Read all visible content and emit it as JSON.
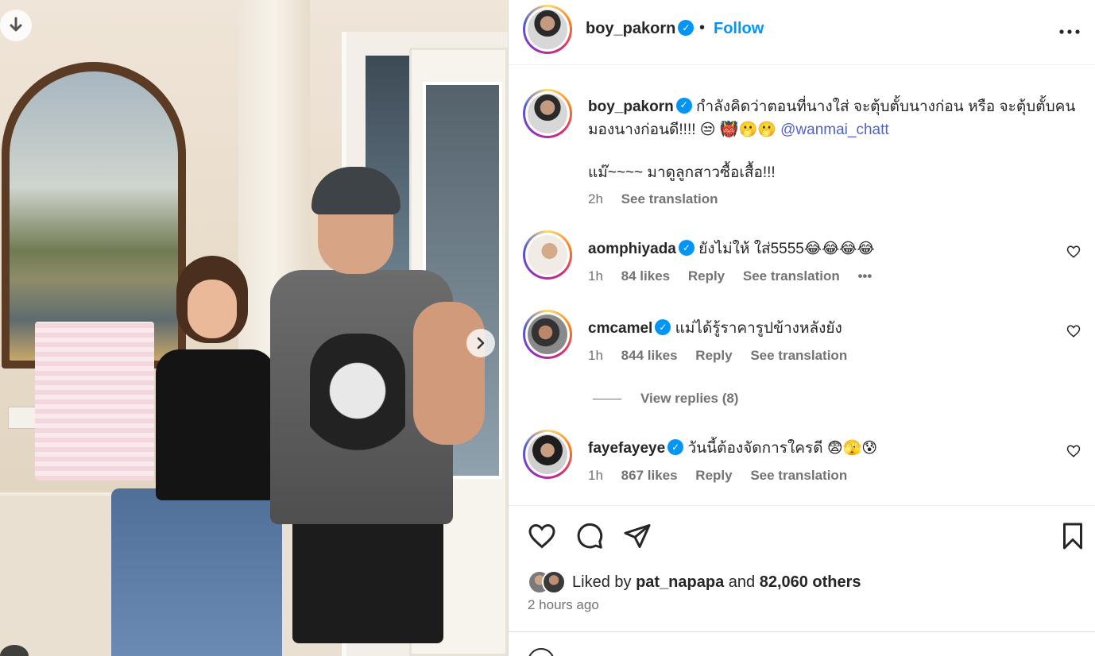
{
  "post": {
    "username": "boy_pakorn",
    "follow_label": "Follow",
    "dot": "•",
    "more_label": "···"
  },
  "caption": {
    "username": "boy_pakorn",
    "text_1": "กำลังคิดว่าตอนที่นางใส่ จะตุ้บตั้บนางก่อน หรือ จะตุ้บตั้บคนมองนางก่อนดี!!!! 😒 👹🫢🫢 ",
    "mention": "@wanmai_chatt",
    "text_2": "แม๊~~~~ มาดูลูกสาวซื้อเสื้อ!!!",
    "time": "2h",
    "see_translation": "See translation"
  },
  "comments": [
    {
      "username": "aomphiyada",
      "text": "ยังไม่ให้ ใส่5555😂😂😂😂",
      "time": "1h",
      "likes": "84 likes",
      "reply": "Reply",
      "see_translation": "See translation",
      "more": "•••"
    },
    {
      "username": "cmcamel",
      "text": "แม่ได้รู้ราคารูปข้างหลังยัง",
      "time": "1h",
      "likes": "844 likes",
      "reply": "Reply",
      "see_translation": "See translation"
    },
    {
      "username": "fayefayeye",
      "text": "วันนี้ต้องจัดการใครดี 😨🫣😰",
      "time": "1h",
      "likes": "867 likes",
      "reply": "Reply",
      "see_translation": "See translation"
    }
  ],
  "view_replies": "View replies (8)",
  "likes": {
    "prefix": "Liked by ",
    "user": "pat_napapa",
    "middle": " and ",
    "others": "82,060 others"
  },
  "time_ago": "2 hours ago",
  "icons": {
    "download": "download-icon",
    "next": "chevron-right-icon",
    "verified": "verified-badge-icon",
    "more": "more-icon",
    "heart": "heart-icon",
    "comment": "comment-icon",
    "share": "share-icon",
    "save": "bookmark-icon"
  }
}
